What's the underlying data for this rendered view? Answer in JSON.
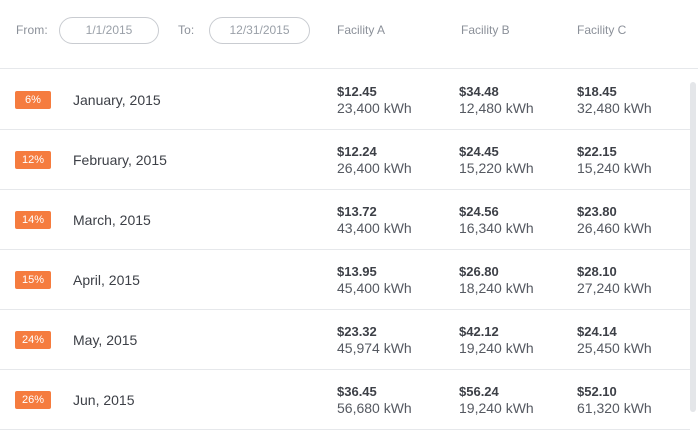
{
  "filters": {
    "from_label": "From:",
    "from_value": "1/1/2015",
    "to_label": "To:",
    "to_value": "12/31/2015"
  },
  "columns": [
    "Facility A",
    "Facility B",
    "Facility C"
  ],
  "colors": {
    "badge": "#f57c3f",
    "text": "#3d4047",
    "muted": "#8b9099",
    "divider": "#e6e8eb"
  },
  "rows": [
    {
      "percent": "6%",
      "month": "January, 2015",
      "facilities": [
        {
          "cost": "$12.45",
          "usage": "23,400 kWh"
        },
        {
          "cost": "$34.48",
          "usage": "12,480 kWh"
        },
        {
          "cost": "$18.45",
          "usage": "32,480 kWh"
        }
      ]
    },
    {
      "percent": "12%",
      "month": "February, 2015",
      "facilities": [
        {
          "cost": "$12.24",
          "usage": "26,400 kWh"
        },
        {
          "cost": "$24.45",
          "usage": "15,220 kWh"
        },
        {
          "cost": "$22.15",
          "usage": "15,240 kWh"
        }
      ]
    },
    {
      "percent": "14%",
      "month": "March, 2015",
      "facilities": [
        {
          "cost": "$13.72",
          "usage": "43,400 kWh"
        },
        {
          "cost": "$24.56",
          "usage": "16,340 kWh"
        },
        {
          "cost": "$23.80",
          "usage": "26,460 kWh"
        }
      ]
    },
    {
      "percent": "15%",
      "month": "April, 2015",
      "facilities": [
        {
          "cost": "$13.95",
          "usage": "45,400 kWh"
        },
        {
          "cost": "$26.80",
          "usage": "18,240 kWh"
        },
        {
          "cost": "$28.10",
          "usage": "27,240 kWh"
        }
      ]
    },
    {
      "percent": "24%",
      "month": "May, 2015",
      "facilities": [
        {
          "cost": "$23.32",
          "usage": "45,974 kWh"
        },
        {
          "cost": "$42.12",
          "usage": "19,240 kWh"
        },
        {
          "cost": "$24.14",
          "usage": "25,450 kWh"
        }
      ]
    },
    {
      "percent": "26%",
      "month": "Jun, 2015",
      "facilities": [
        {
          "cost": "$36.45",
          "usage": "56,680 kWh"
        },
        {
          "cost": "$56.24",
          "usage": "19,240 kWh"
        },
        {
          "cost": "$52.10",
          "usage": "61,320 kWh"
        }
      ]
    }
  ]
}
